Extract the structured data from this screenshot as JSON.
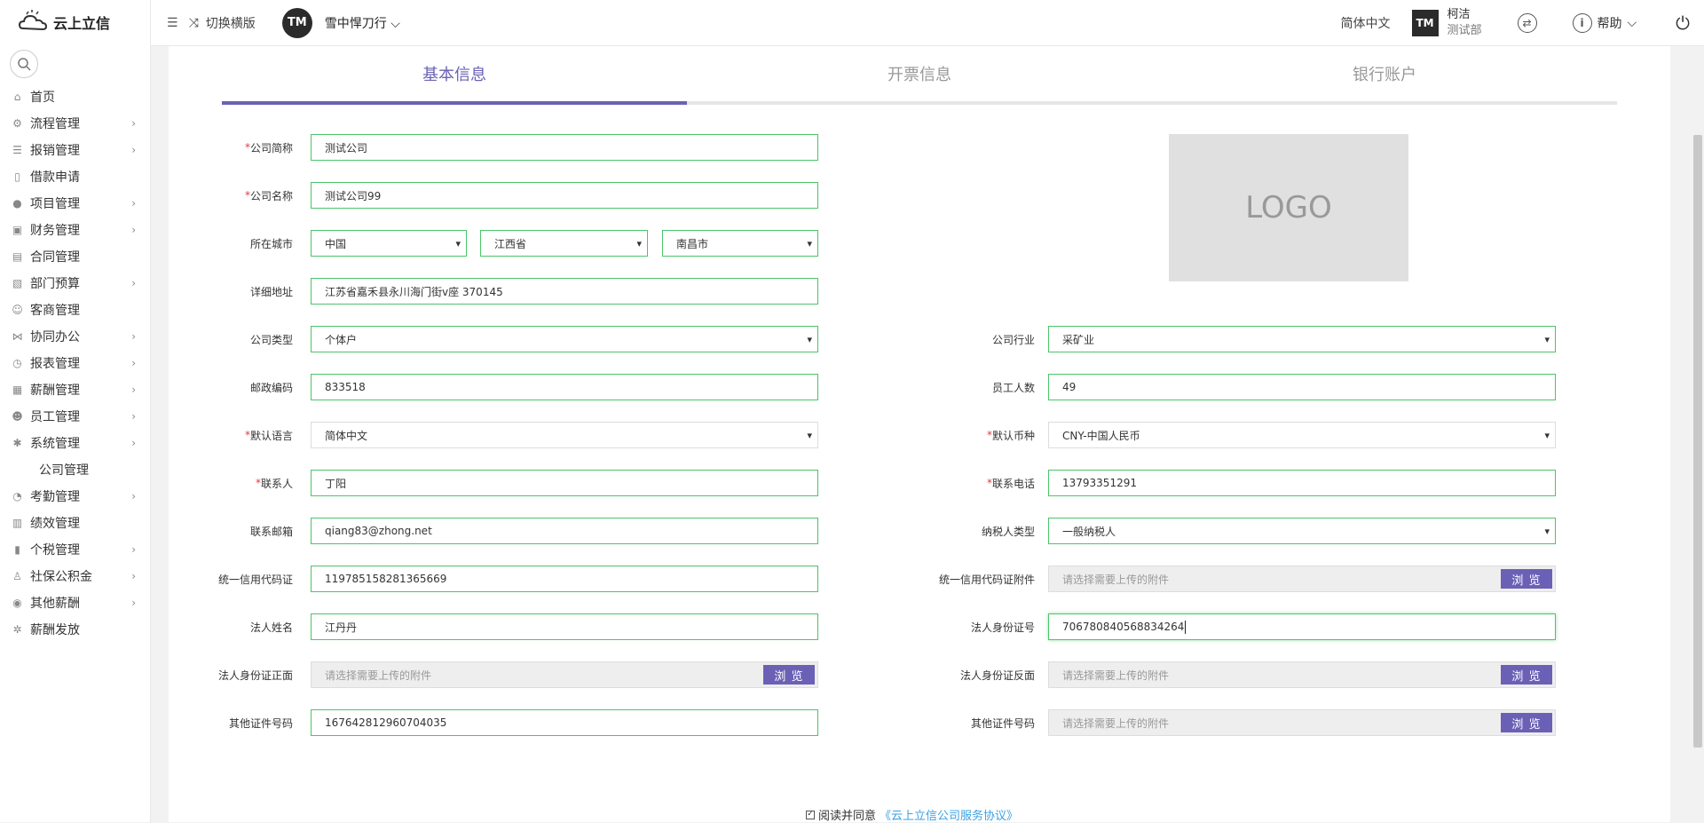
{
  "app": {
    "name": "云上立信"
  },
  "sidebar": {
    "items": [
      {
        "label": "首页",
        "icon": "home-icon",
        "glyph": "⌂",
        "expandable": false
      },
      {
        "label": "流程管理",
        "icon": "flow-icon",
        "glyph": "⚙",
        "expandable": true
      },
      {
        "label": "报销管理",
        "icon": "list-icon",
        "glyph": "☰",
        "expandable": true
      },
      {
        "label": "借款申请",
        "icon": "clipboard-icon",
        "glyph": "▯",
        "expandable": false
      },
      {
        "label": "项目管理",
        "icon": "user-icon",
        "glyph": "●",
        "expandable": true
      },
      {
        "label": "财务管理",
        "icon": "wallet-icon",
        "glyph": "▣",
        "expandable": true
      },
      {
        "label": "合同管理",
        "icon": "document-icon",
        "glyph": "▤",
        "expandable": false
      },
      {
        "label": "部门预算",
        "icon": "budget-icon",
        "glyph": "▧",
        "expandable": true
      },
      {
        "label": "客商管理",
        "icon": "contacts-icon",
        "glyph": "☺",
        "expandable": false
      },
      {
        "label": "协同办公",
        "icon": "share-icon",
        "glyph": "⋈",
        "expandable": true
      },
      {
        "label": "报表管理",
        "icon": "clock-icon",
        "glyph": "◷",
        "expandable": true
      },
      {
        "label": "薪酬管理",
        "icon": "grid-icon",
        "glyph": "▦",
        "expandable": true
      },
      {
        "label": "员工管理",
        "icon": "team-icon",
        "glyph": "☻",
        "expandable": true
      },
      {
        "label": "系统管理",
        "icon": "gear-icon",
        "glyph": "✱",
        "expandable": true
      }
    ],
    "sub_item": "公司管理",
    "items_after": [
      {
        "label": "考勤管理",
        "icon": "attendance-icon",
        "glyph": "◔",
        "expandable": true
      },
      {
        "label": "绩效管理",
        "icon": "performance-icon",
        "glyph": "▥",
        "expandable": false
      },
      {
        "label": "个税管理",
        "icon": "tax-icon",
        "glyph": "▮",
        "expandable": true
      },
      {
        "label": "社保公积金",
        "icon": "person-icon",
        "glyph": "♙",
        "expandable": true
      },
      {
        "label": "其他薪酬",
        "icon": "circle-icon",
        "glyph": "◉",
        "expandable": true
      },
      {
        "label": "薪酬发放",
        "icon": "settings-icon",
        "glyph": "✲",
        "expandable": false
      }
    ]
  },
  "topbar": {
    "switch_label": "切换横版",
    "avatar_initials": "TM",
    "company": "雪中悍刀行",
    "language": "简体中文",
    "user_name": "柯洁",
    "user_dept": "测试部",
    "help": "帮助"
  },
  "tabs": [
    "基本信息",
    "开票信息",
    "银行账户"
  ],
  "form": {
    "short_name": {
      "label": "公司简称",
      "value": "测试公司"
    },
    "full_name": {
      "label": "公司名称",
      "value": "测试公司99"
    },
    "city": {
      "label": "所在城市",
      "country": "中国",
      "province": "江西省",
      "city": "南昌市"
    },
    "address": {
      "label": "详细地址",
      "value": "江苏省嘉禾县永川海门街v座 370145"
    },
    "company_type": {
      "label": "公司类型",
      "value": "个体户"
    },
    "industry": {
      "label": "公司行业",
      "value": "采矿业"
    },
    "postcode": {
      "label": "邮政编码",
      "value": "833518"
    },
    "employees": {
      "label": "员工人数",
      "value": "49"
    },
    "language": {
      "label": "默认语言",
      "value": "简体中文"
    },
    "currency": {
      "label": "默认币种",
      "value": "CNY-中国人民币"
    },
    "contact": {
      "label": "联系人",
      "value": "丁阳"
    },
    "phone": {
      "label": "联系电话",
      "value": "13793351291"
    },
    "email": {
      "label": "联系邮箱",
      "value": "qiang83@zhong.net"
    },
    "taxpayer_type": {
      "label": "纳税人类型",
      "value": "一般纳税人"
    },
    "credit_code": {
      "label": "统一信用代码证",
      "value": "119785158281365669"
    },
    "credit_attach": {
      "label": "统一信用代码证附件",
      "placeholder": "请选择需要上传的附件"
    },
    "legal_name": {
      "label": "法人姓名",
      "value": "江丹丹"
    },
    "legal_id": {
      "label": "法人身份证号",
      "value": "706780840568834264"
    },
    "id_front": {
      "label": "法人身份证正面",
      "placeholder": "请选择需要上传的附件"
    },
    "id_back": {
      "label": "法人身份证反面",
      "placeholder": "请选择需要上传的附件"
    },
    "other_id": {
      "label": "其他证件号码",
      "value": "167642812960704035"
    },
    "other_attach": {
      "label": "其他证件号码",
      "placeholder": "请选择需要上传的附件"
    },
    "browse": "浏 览",
    "logo": "LOGO"
  },
  "agreement": {
    "prefix": "阅读并同意",
    "link": "《云上立信公司服务协议》"
  },
  "colors": {
    "accent": "#6a61b6",
    "input_border": "#4cc46a",
    "required": "#e4393c",
    "link": "#3aa0e6"
  }
}
